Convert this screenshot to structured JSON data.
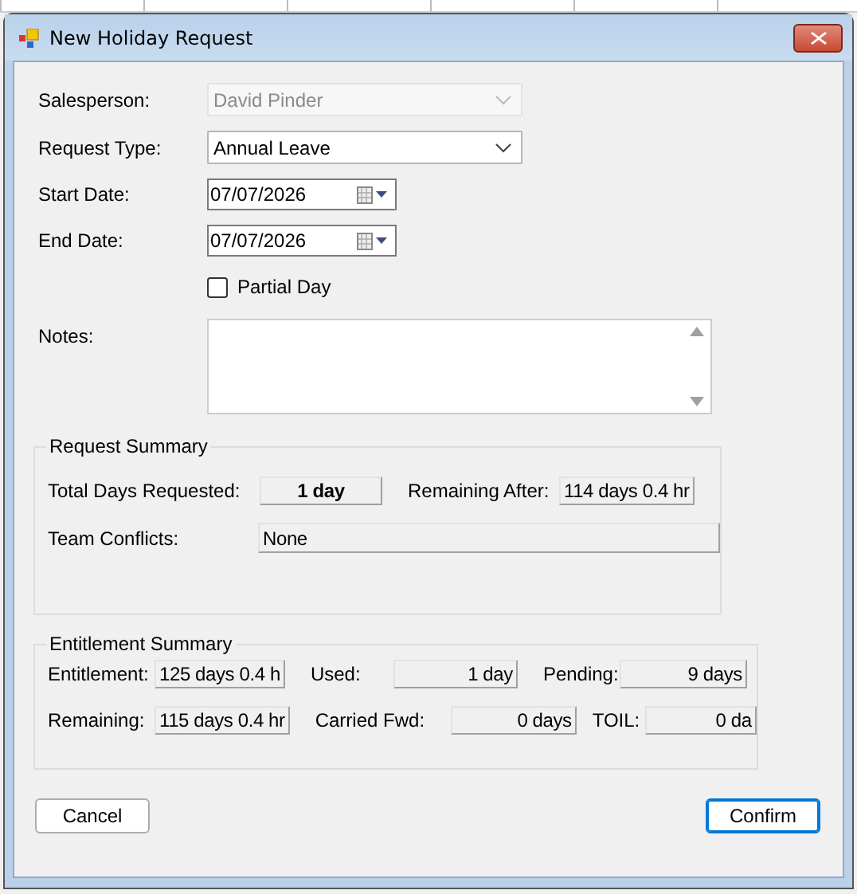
{
  "window": {
    "title": "New Holiday Request"
  },
  "form": {
    "salesperson": {
      "label": "Salesperson:",
      "value": "David Pinder",
      "disabled": true
    },
    "request_type": {
      "label": "Request Type:",
      "value": "Annual Leave",
      "disabled": false
    },
    "start_date": {
      "label": "Start Date:",
      "value": "07/07/2026"
    },
    "end_date": {
      "label": "End Date:",
      "value": "07/07/2026"
    },
    "partial_day": {
      "label": "Partial Day",
      "checked": false
    },
    "notes": {
      "label": "Notes:"
    }
  },
  "request_summary": {
    "title": "Request Summary",
    "total_days": {
      "label": "Total Days Requested:",
      "value": "1 day"
    },
    "remaining_after": {
      "label": "Remaining After:",
      "value": "114 days 0.4 hr"
    },
    "team_conflicts": {
      "label": "Team Conflicts:",
      "value": "None"
    }
  },
  "entitlement_summary": {
    "title": "Entitlement Summary",
    "rows": [
      [
        {
          "label": "Entitlement:",
          "value": "125 days 0.4 h"
        },
        {
          "label": "Used:",
          "value": "1 day"
        },
        {
          "label": "Pending:",
          "value": "9 days"
        }
      ],
      [
        {
          "label": "Remaining:",
          "value": "115 days 0.4 hr"
        },
        {
          "label": "Carried Fwd:",
          "value": "0 days"
        },
        {
          "label": "TOIL:",
          "value": "0 da"
        }
      ]
    ]
  },
  "buttons": [
    {
      "label": "Cancel",
      "default": false
    },
    {
      "label": "Confirm",
      "default": true
    }
  ]
}
